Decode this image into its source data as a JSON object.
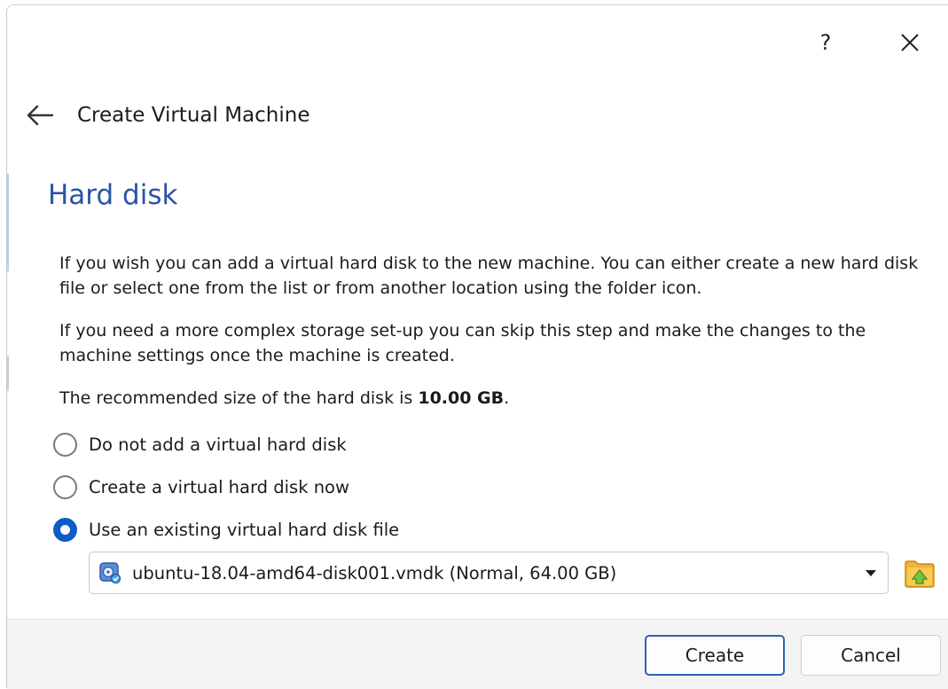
{
  "window": {
    "help_label": "?",
    "title": "Create Virtual Machine"
  },
  "page": {
    "heading": "Hard disk",
    "paragraph1": "If you wish you can add a virtual hard disk to the new machine. You can either create a new hard disk file or select one from the list or from another location using the folder icon.",
    "paragraph2": "If you need a more complex storage set-up you can skip this step and make the changes to the machine settings once the machine is created.",
    "recommended_prefix": "The recommended size of the hard disk is ",
    "recommended_size": "10.00 GB",
    "recommended_suffix": "."
  },
  "options": [
    {
      "label": "Do not add a virtual hard disk",
      "checked": false
    },
    {
      "label": "Create a virtual hard disk now",
      "checked": false
    },
    {
      "label": "Use an existing virtual hard disk file",
      "checked": true
    }
  ],
  "disk_select": {
    "value": "ubuntu-18.04-amd64-disk001.vmdk (Normal, 64.00 GB)",
    "icon": "hard-disk-icon"
  },
  "footer": {
    "create_label": "Create",
    "cancel_label": "Cancel"
  },
  "colors": {
    "heading": "#2a54a6",
    "accent": "#0f5cc4",
    "primary_button_border": "#2b62b8",
    "footer_bg": "#f3f3f3"
  }
}
